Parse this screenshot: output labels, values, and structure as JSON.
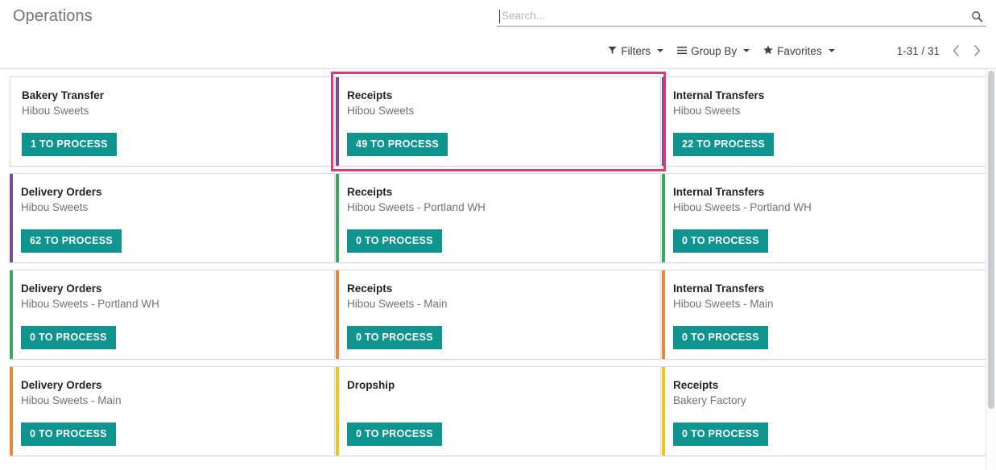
{
  "header": {
    "title": "Operations",
    "search": {
      "placeholder": "Search...",
      "value": "",
      "icon": "search-icon"
    },
    "filters": [
      {
        "label": "Filters",
        "icon": "funnel-icon",
        "glyph": "▼"
      },
      {
        "label": "Group By",
        "icon": "hamburger-icon",
        "glyph": "☰"
      },
      {
        "label": "Favorites",
        "icon": "star-icon",
        "glyph": "★"
      }
    ],
    "pager": {
      "range": "1-31 / 31",
      "prev_icon": "chevron-left-icon",
      "prev_glyph": "‹",
      "next_icon": "chevron-right-icon",
      "next_glyph": "›"
    }
  },
  "colors": {
    "accent_teal": "#0f9490",
    "stripe_purple": "#7c4b9e",
    "stripe_green": "#3aaa5d",
    "stripe_orange": "#e9873d",
    "stripe_yellow": "#f0c419",
    "highlight_pink": "#e03a70",
    "title_gray": "#71757b"
  },
  "cards": [
    {
      "title": "Bakery Transfer",
      "subtitle": "Hibou Sweets",
      "button": "1 TO PROCESS",
      "stripe": "none",
      "highlighted": false
    },
    {
      "title": "Receipts",
      "subtitle": "Hibou Sweets",
      "button": "49 TO PROCESS",
      "stripe": "purple",
      "highlighted": true
    },
    {
      "title": "Internal Transfers",
      "subtitle": "Hibou Sweets",
      "button": "22 TO PROCESS",
      "stripe": "purple",
      "highlighted": false
    },
    {
      "title": "Delivery Orders",
      "subtitle": "Hibou Sweets",
      "button": "62 TO PROCESS",
      "stripe": "purple",
      "highlighted": false
    },
    {
      "title": "Receipts",
      "subtitle": "Hibou Sweets - Portland WH",
      "button": "0 TO PROCESS",
      "stripe": "green",
      "highlighted": false
    },
    {
      "title": "Internal Transfers",
      "subtitle": "Hibou Sweets - Portland WH",
      "button": "0 TO PROCESS",
      "stripe": "green",
      "highlighted": false
    },
    {
      "title": "Delivery Orders",
      "subtitle": "Hibou Sweets - Portland WH",
      "button": "0 TO PROCESS",
      "stripe": "green",
      "highlighted": false
    },
    {
      "title": "Receipts",
      "subtitle": "Hibou Sweets - Main",
      "button": "0 TO PROCESS",
      "stripe": "orange",
      "highlighted": false
    },
    {
      "title": "Internal Transfers",
      "subtitle": "Hibou Sweets - Main",
      "button": "0 TO PROCESS",
      "stripe": "orange",
      "highlighted": false
    },
    {
      "title": "Delivery Orders",
      "subtitle": "Hibou Sweets - Main",
      "button": "0 TO PROCESS",
      "stripe": "orange",
      "highlighted": false
    },
    {
      "title": "Dropship",
      "subtitle": "",
      "button": "0 TO PROCESS",
      "stripe": "yellow",
      "highlighted": false
    },
    {
      "title": "Receipts",
      "subtitle": "Bakery Factory",
      "button": "0 TO PROCESS",
      "stripe": "yellow",
      "highlighted": false
    }
  ]
}
